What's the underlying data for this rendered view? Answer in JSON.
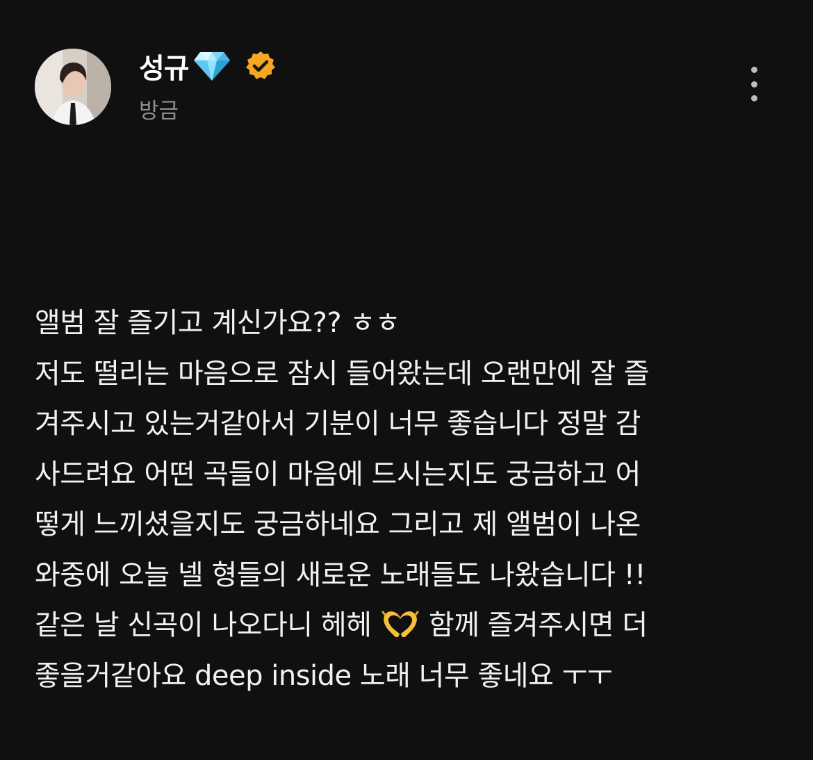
{
  "post": {
    "author": {
      "name": "성규",
      "name_emoji": "gem-icon",
      "verified": true,
      "verified_badge": "verified-badge-icon",
      "avatar": "profile-photo"
    },
    "time": "방금",
    "menu_icon": "more-vertical-icon",
    "body_lines": [
      "앨범 잘 즐기고 계신가요?? ㅎㅎ",
      "저도 떨리는 마음으로 잠시 들어왔는데 오랜만에 잘 즐",
      "겨주시고 있는거같아서 기분이 너무 좋습니다 정말 감",
      "사드려요 어떤 곡들이 마음에 드시는지도 궁금하고 어",
      "떻게 느끼셨을지도 궁금하네요 그리고 제 앨범이 나온",
      "와중에 오늘 넬 형들의 새로운 노래들도 나왔습니다 !!"
    ],
    "line7_before_emoji": "같은 날 신곡이 나오다니 헤헤 ",
    "line7_emoji": "heart-hands-emoji",
    "line7_after_emoji": " 함께 즐겨주시면 더",
    "line8": "좋을거같아요 deep inside 노래 너무 좋네요 ㅜㅜ"
  },
  "colors": {
    "background": "#101010",
    "text": "#f2f2f2",
    "muted": "#8f8f8f",
    "verified": "#f5a623",
    "gem": "#6fd3ff"
  }
}
